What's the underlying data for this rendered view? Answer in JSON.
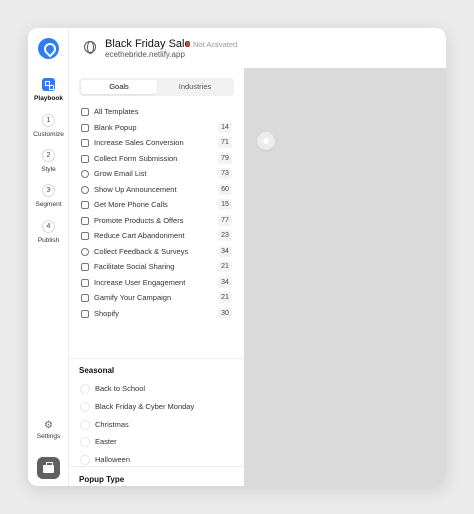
{
  "header": {
    "site_name": "Black Friday Sale",
    "status": "Not Activated",
    "url": "ecethebride.netlify.app"
  },
  "rail": {
    "steps": [
      {
        "num": "",
        "label": "Playbook"
      },
      {
        "num": "1",
        "label": "Customize"
      },
      {
        "num": "2",
        "label": "Style"
      },
      {
        "num": "3",
        "label": "Segment"
      },
      {
        "num": "4",
        "label": "Publish"
      }
    ],
    "settings_label": "Settings"
  },
  "tabs": {
    "goals": "Goals",
    "industries": "Industries"
  },
  "goals": [
    {
      "label": "All Templates",
      "count": "",
      "icon": "grid-icon"
    },
    {
      "label": "Blank Popup",
      "count": "14",
      "icon": "blank-popup-icon"
    },
    {
      "label": "Increase Sales Conversion",
      "count": "71",
      "icon": "chart-line-icon"
    },
    {
      "label": "Collect Form Submission",
      "count": "79",
      "icon": "form-icon"
    },
    {
      "label": "Grow Email List",
      "count": "73",
      "icon": "mail-icon"
    },
    {
      "label": "Show Up Announcement",
      "count": "60",
      "icon": "megaphone-icon"
    },
    {
      "label": "Get More Phone Calls",
      "count": "15",
      "icon": "headphones-icon"
    },
    {
      "label": "Promote Products & Offers",
      "count": "77",
      "icon": "tag-icon"
    },
    {
      "label": "Reduce Cart Abandonment",
      "count": "23",
      "icon": "cart-icon"
    },
    {
      "label": "Collect Feedback & Surveys",
      "count": "34",
      "icon": "feedback-icon"
    },
    {
      "label": "Facilitate Social Sharing",
      "count": "21",
      "icon": "heart-icon"
    },
    {
      "label": "Increase User Engagement",
      "count": "34",
      "icon": "users-icon"
    },
    {
      "label": "Gamify Your Campaign",
      "count": "21",
      "icon": "game-icon"
    },
    {
      "label": "Shopify",
      "count": "30",
      "icon": "shopify-icon"
    }
  ],
  "seasonal": {
    "title": "Seasonal",
    "items": [
      "Back to School",
      "Black Friday & Cyber Monday",
      "Christmas",
      "Easter",
      "Halloween"
    ]
  },
  "popup_type": {
    "title": "Popup Type"
  },
  "colors": {
    "accent": "#2f7df6",
    "status_dot": "#e53935",
    "preview_bg": "#dadada"
  }
}
